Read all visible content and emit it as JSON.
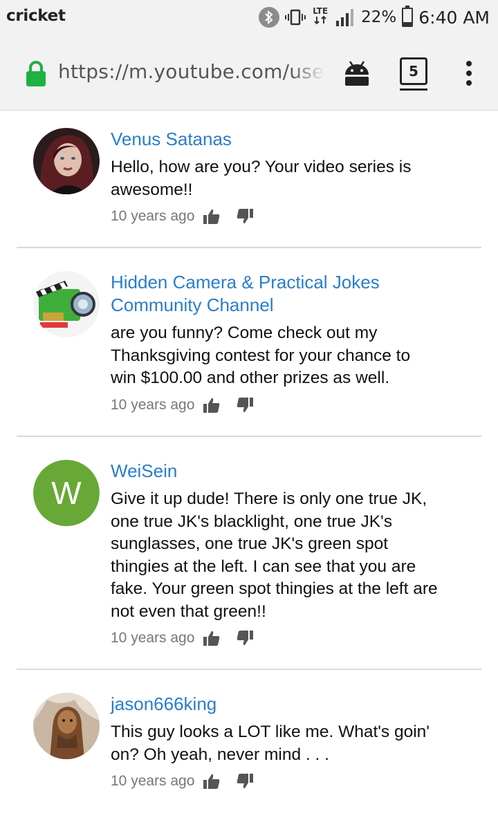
{
  "status_bar": {
    "carrier": "cricket",
    "network": "LTE",
    "battery_percent": "22%",
    "time": "6:40 AM",
    "icons": [
      "bluetooth-icon",
      "vibrate-icon",
      "lte-icon",
      "signal-icon",
      "battery-icon"
    ]
  },
  "browser": {
    "url": "https://m.youtube.com/user/",
    "tab_count": "5",
    "icons": [
      "lock-icon",
      "android-icon",
      "overflow-menu-icon"
    ]
  },
  "comments": [
    {
      "author": "Venus Satanas",
      "text": "Hello, how are you? Your video series is awesome!!",
      "time": "10 years ago"
    },
    {
      "author": "Hidden Camera & Practical Jokes Community Channel",
      "text": "are you funny? Come check out my Thanksgiving contest for your chance to win $100.00 and other prizes as well.",
      "time": "10 years ago"
    },
    {
      "author": "WeiSein",
      "avatar_letter": "W",
      "text": "Give it up dude! There is only one true JK, one true JK's blacklight, one true JK's sunglasses, one true JK's green spot thingies at the left. I can see that you are fake. Your green spot thingies at the left are not even that green!!",
      "time": "10 years ago"
    },
    {
      "author": "jason666king",
      "text": "This guy looks a LOT like me. What's goin' on? Oh yeah, never mind . . .",
      "time": "10 years ago"
    }
  ],
  "colors": {
    "author_link": "#2a7dcb",
    "lock_green": "#1fb141",
    "avatar_w_bg": "#67a836",
    "chrome_bg": "#f2f2f2"
  }
}
